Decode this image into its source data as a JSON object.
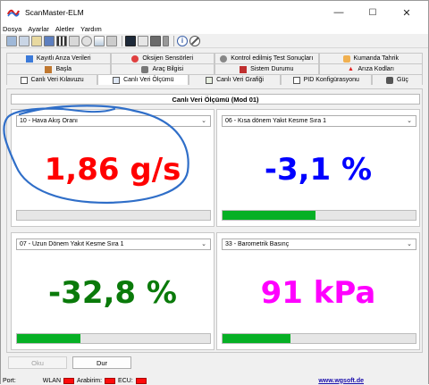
{
  "window": {
    "title": "ScanMaster-ELM",
    "min": "—",
    "max": "☐",
    "close": "✕"
  },
  "menu": [
    "Dosya",
    "Ayarlar",
    "Aletler",
    "Yardım"
  ],
  "tabs": {
    "row1": [
      "Kayıtlı Arıza Verileri",
      "Oksijen Sensörleri",
      "Kontrol edilmiş Test Sonuçları",
      "Kumanda Tahrik"
    ],
    "row2": [
      "Başla",
      "Araç Bilgisi",
      "Sistem Durumu",
      "Arıza Kodları"
    ],
    "row3": [
      "Canlı Veri Kılavuzu",
      "Canlı Veri Ölçümü",
      "Canlı Veri Grafiği",
      "PID Konfigürasyonu",
      "Güç"
    ],
    "selected": "Canlı Veri Ölçümü"
  },
  "panel": {
    "title": "Canlı Veri Ölçümü (Mod 01)"
  },
  "gauges": [
    {
      "pid": "10 - Hava Akış Oranı",
      "value": "1,86 g/s",
      "color": "#ff0000",
      "level": 0
    },
    {
      "pid": "06 - Kısa dönem Yakıt Kesme Sıra 1",
      "value": "-3,1 %",
      "color": "#0000ff",
      "level": 0.48
    },
    {
      "pid": "07 - Uzun Dönem Yakıt Kesme Sıra 1",
      "value": "-32,8 %",
      "color": "#0a7a0a",
      "level": 0.33
    },
    {
      "pid": "33 - Barometrik Basınç",
      "value": "91 kPa",
      "color": "#ff00ff",
      "level": 0.35
    }
  ],
  "buttons": {
    "read": "Oku",
    "stop": "Dur"
  },
  "status": {
    "port": "Port:",
    "wlan": "WLAN",
    "vehicle": "Arabirim:",
    "ecu": "ECU:",
    "website": "www.wgsoft.de"
  },
  "colors": {
    "progress": "#06b025",
    "led": "#ff0a0a",
    "link": "#1a0dab"
  }
}
